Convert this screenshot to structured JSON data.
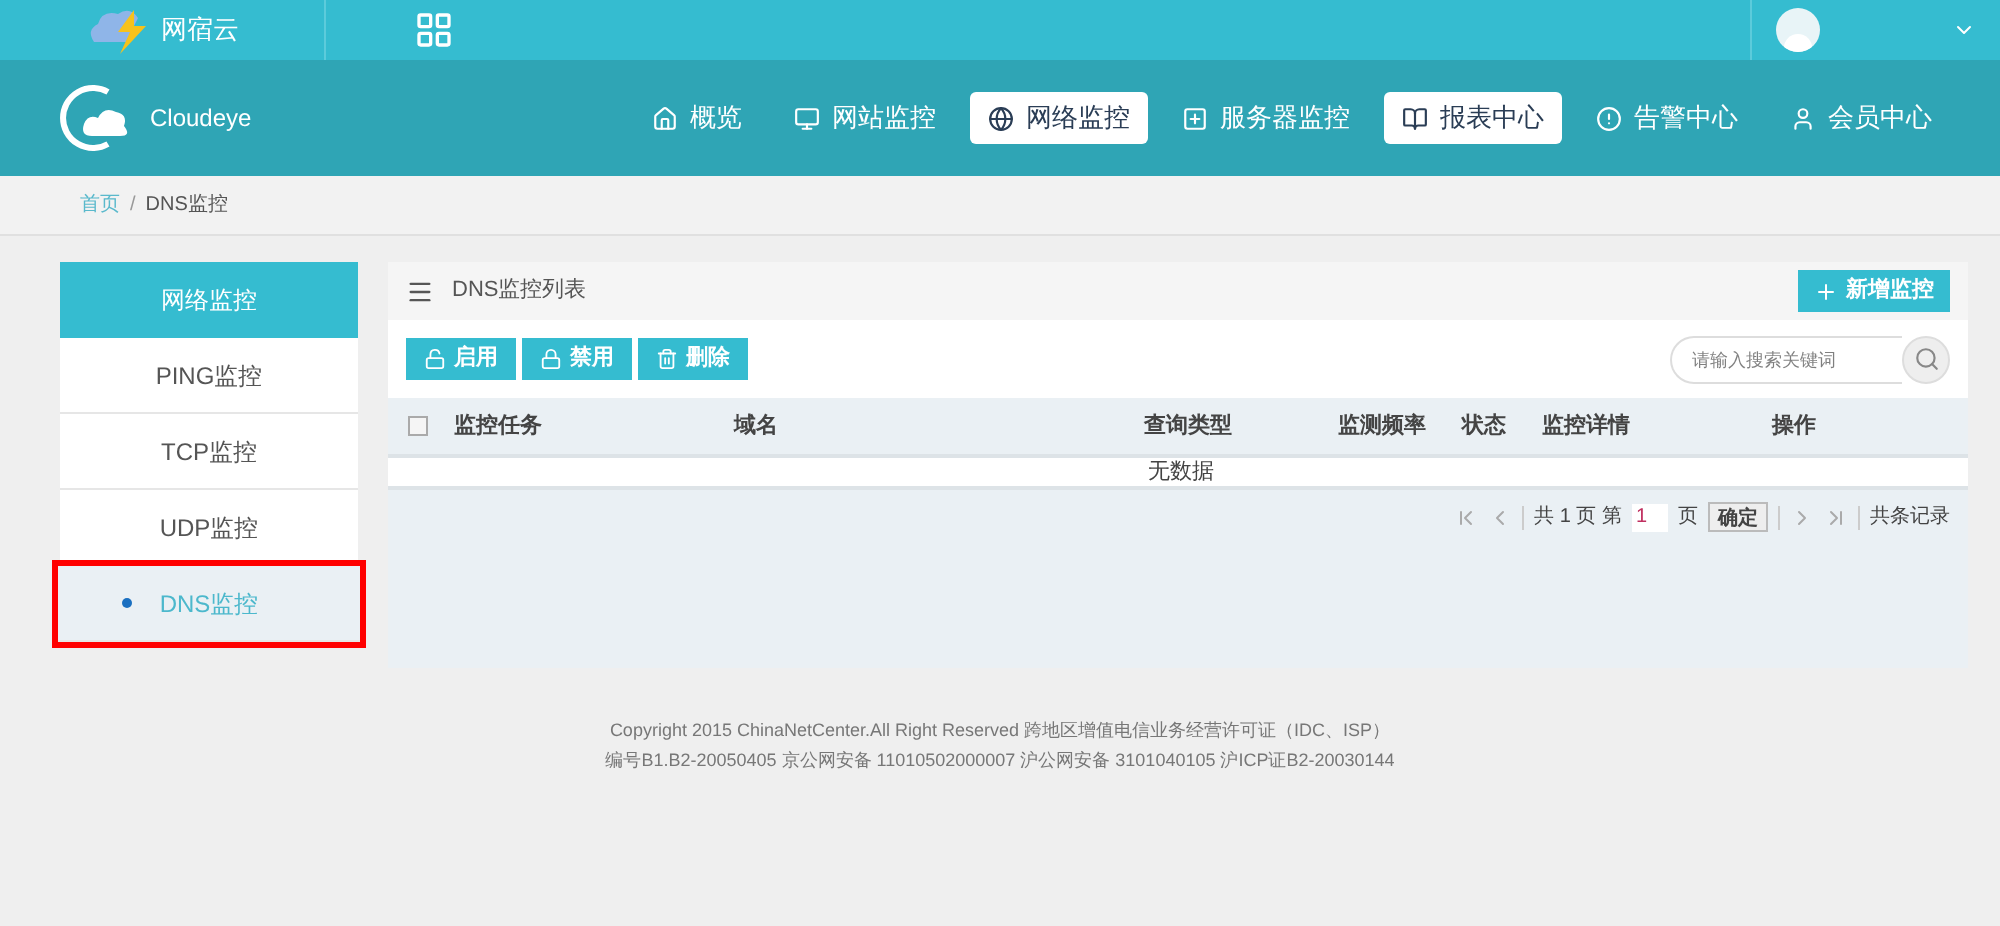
{
  "topbar": {
    "brand": "网宿云"
  },
  "header": {
    "logo": "Cloudeye",
    "nav": [
      {
        "label": "概览",
        "selected": false
      },
      {
        "label": "网站监控",
        "selected": false
      },
      {
        "label": "网络监控",
        "selected": true
      },
      {
        "label": "服务器监控",
        "selected": false
      },
      {
        "label": "报表中心",
        "selected": true
      },
      {
        "label": "告警中心",
        "selected": false
      },
      {
        "label": "会员中心",
        "selected": false
      }
    ]
  },
  "breadcrumb": {
    "home": "首页",
    "separator": "/",
    "current": "DNS监控"
  },
  "sidebar": {
    "title": "网络监控",
    "items": [
      {
        "label": "PING监控",
        "selected": false,
        "highlighted": false
      },
      {
        "label": "TCP监控",
        "selected": false,
        "highlighted": false
      },
      {
        "label": "UDP监控",
        "selected": false,
        "highlighted": false
      },
      {
        "label": "DNS监控",
        "selected": true,
        "highlighted": true
      }
    ]
  },
  "panel": {
    "title": "DNS监控列表",
    "add_button": "新增监控",
    "actions": [
      {
        "label": "启用"
      },
      {
        "label": "禁用"
      },
      {
        "label": "删除"
      }
    ],
    "search": {
      "placeholder": "请输入搜索关键词"
    },
    "table": {
      "select_all": {
        "checked": false
      },
      "columns": [
        "监控任务",
        "域名",
        "查询类型",
        "监测频率",
        "状态",
        "监控详情",
        "操作"
      ],
      "empty": "无数据"
    },
    "pagination": {
      "total_prefix": "共",
      "total_pages": "1",
      "page_word": "页",
      "page_prefix": "第",
      "page": "1",
      "page_suffix": "页",
      "confirm": "确定",
      "records": "共条记录"
    }
  },
  "footer": {
    "lines": [
      "Copyright 2015 ChinaNetCenter.All Right Reserved 跨地区增值电信业务经营许可证（IDC、ISP）",
      "编号B1.B2-20050405 京公网安备 11010502000007 沪公网安备 3101040105 沪ICP证B2-20030144"
    ]
  }
}
